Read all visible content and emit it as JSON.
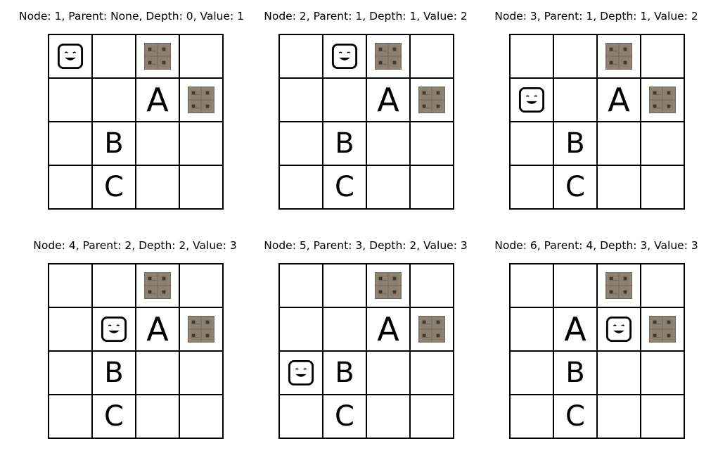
{
  "panels": [
    {
      "title": "Node: 1, Parent: None, Depth: 0, Value: 1",
      "grid": [
        [
          "agent",
          "",
          "wall",
          ""
        ],
        [
          "",
          "",
          "A",
          "wall"
        ],
        [
          "",
          "B",
          "",
          ""
        ],
        [
          "",
          "C",
          "",
          ""
        ]
      ]
    },
    {
      "title": "Node: 2, Parent: 1, Depth: 1, Value: 2",
      "grid": [
        [
          "",
          "agent",
          "wall",
          ""
        ],
        [
          "",
          "",
          "A",
          "wall"
        ],
        [
          "",
          "B",
          "",
          ""
        ],
        [
          "",
          "C",
          "",
          ""
        ]
      ]
    },
    {
      "title": "Node: 3, Parent: 1, Depth: 1, Value: 2",
      "grid": [
        [
          "",
          "",
          "wall",
          ""
        ],
        [
          "agent",
          "",
          "A",
          "wall"
        ],
        [
          "",
          "B",
          "",
          ""
        ],
        [
          "",
          "C",
          "",
          ""
        ]
      ]
    },
    {
      "title": "Node: 4, Parent: 2, Depth: 2, Value: 3",
      "grid": [
        [
          "",
          "",
          "wall",
          ""
        ],
        [
          "",
          "agent",
          "A",
          "wall"
        ],
        [
          "",
          "B",
          "",
          ""
        ],
        [
          "",
          "C",
          "",
          ""
        ]
      ]
    },
    {
      "title": "Node: 5, Parent: 3, Depth: 2, Value: 3",
      "grid": [
        [
          "",
          "",
          "wall",
          ""
        ],
        [
          "",
          "",
          "A",
          "wall"
        ],
        [
          "agent",
          "B",
          "",
          ""
        ],
        [
          "",
          "C",
          "",
          ""
        ]
      ]
    },
    {
      "title": "Node: 6, Parent: 4, Depth: 3, Value: 3",
      "grid": [
        [
          "",
          "",
          "wall",
          ""
        ],
        [
          "",
          "A",
          "agent",
          "wall"
        ],
        [
          "",
          "B",
          "",
          ""
        ],
        [
          "",
          "C",
          "",
          ""
        ]
      ]
    }
  ],
  "colors": {
    "wall_base": "#8b8070",
    "wall_dark": "#3e3a33",
    "grid_line": "#000000"
  },
  "icons": {
    "agent": "smiley-face-icon",
    "wall": "stone-wall-icon"
  }
}
